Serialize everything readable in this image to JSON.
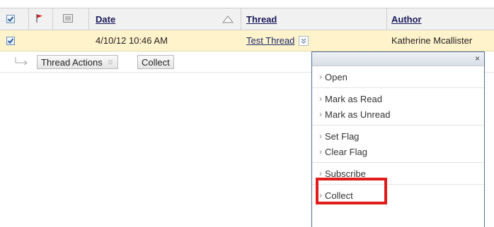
{
  "table": {
    "headers": {
      "date": "Date",
      "thread": "Thread",
      "author": "Author"
    },
    "row": {
      "date": "4/10/12 10:46 AM",
      "thread": "Test Thread",
      "author": "Katherine Mcallister"
    }
  },
  "actions": {
    "thread_actions": "Thread Actions",
    "collect": "Collect"
  },
  "menu": {
    "close": "×",
    "groups": [
      [
        "Open"
      ],
      [
        "Mark as Read",
        "Mark as Unread"
      ],
      [
        "Set Flag",
        "Clear Flag"
      ],
      [
        "Subscribe"
      ],
      [
        "Collect"
      ]
    ]
  },
  "colors": {
    "row_highlight": "#fff3cc",
    "menu_border": "#4f6d9a",
    "callout": "#e21b1b"
  },
  "icons": {
    "flag": "flag-icon",
    "read_status": "read-status-icon",
    "checkbox": "checkbox-icon",
    "chevron": "chevron-down-icon",
    "sort": "sort-ascending-icon",
    "arrow": "tree-arrow-icon"
  }
}
